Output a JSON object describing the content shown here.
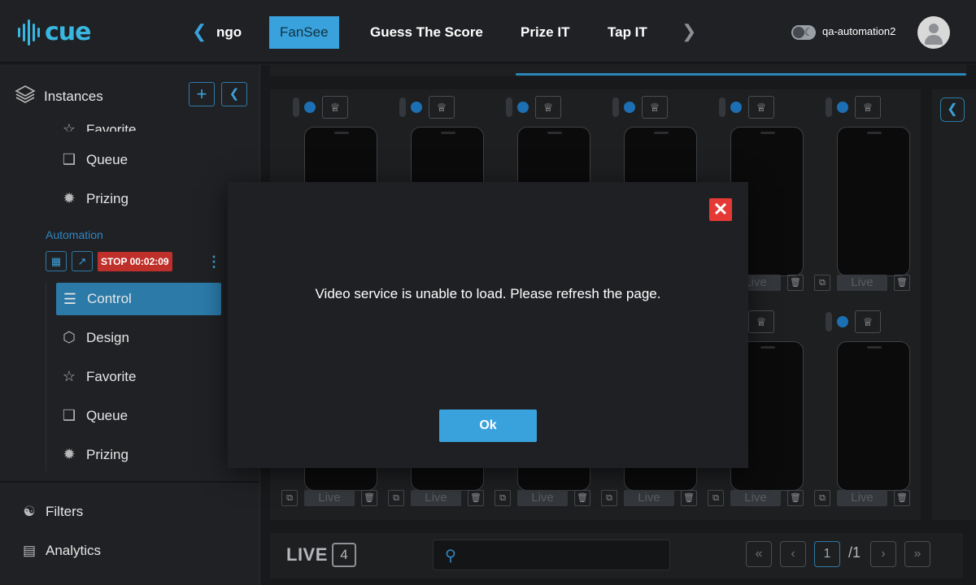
{
  "app": {
    "logo_text": "cue",
    "brand_color": "#39b7e0"
  },
  "nav": {
    "prev_icon": "chevron-left-icon",
    "next_icon": "chevron-right-icon",
    "tabs": [
      {
        "label": "ngo",
        "active": false
      },
      {
        "label": "FanSee",
        "active": true
      },
      {
        "label": "Guess The Score",
        "active": false
      },
      {
        "label": "Prize IT",
        "active": false
      },
      {
        "label": "Tap IT",
        "active": false
      }
    ]
  },
  "user": {
    "theme_toggle_icon": "moon-icon",
    "name": "qa-automation2",
    "avatar_icon": "user-avatar-icon"
  },
  "sidebar": {
    "header_label": "Instances",
    "add_button_icon": "plus-icon",
    "collapse_button_icon": "chevron-left-icon",
    "upper_items": [
      {
        "label": "Favorite",
        "icon": "star-icon"
      },
      {
        "label": "Queue",
        "icon": "queue-icon"
      },
      {
        "label": "Prizing",
        "icon": "award-icon"
      }
    ],
    "automation": {
      "label": "Automation",
      "stop_label": "STOP 00:02:09",
      "stop_color": "#c0302b"
    },
    "items": [
      {
        "label": "Control",
        "icon": "sliders-icon",
        "active": true
      },
      {
        "label": "Design",
        "icon": "cube-icon",
        "active": false
      },
      {
        "label": "Favorite",
        "icon": "star-icon",
        "active": false
      },
      {
        "label": "Queue",
        "icon": "queue-icon",
        "active": false
      },
      {
        "label": "Prizing",
        "icon": "award-icon",
        "active": false
      }
    ],
    "footer": [
      {
        "label": "Filters",
        "icon": "filters-icon"
      },
      {
        "label": "Analytics",
        "icon": "analytics-icon"
      }
    ]
  },
  "grid": {
    "live_button_label": "Live"
  },
  "bottom_bar": {
    "live_label": "LIVE",
    "live_count": "4",
    "search_placeholder": "",
    "current_page": "1",
    "total_pages": "/1"
  },
  "modal": {
    "message": "Video service is unable to load. Please refresh the page.",
    "ok_label": "Ok",
    "close_color": "#e53935"
  }
}
